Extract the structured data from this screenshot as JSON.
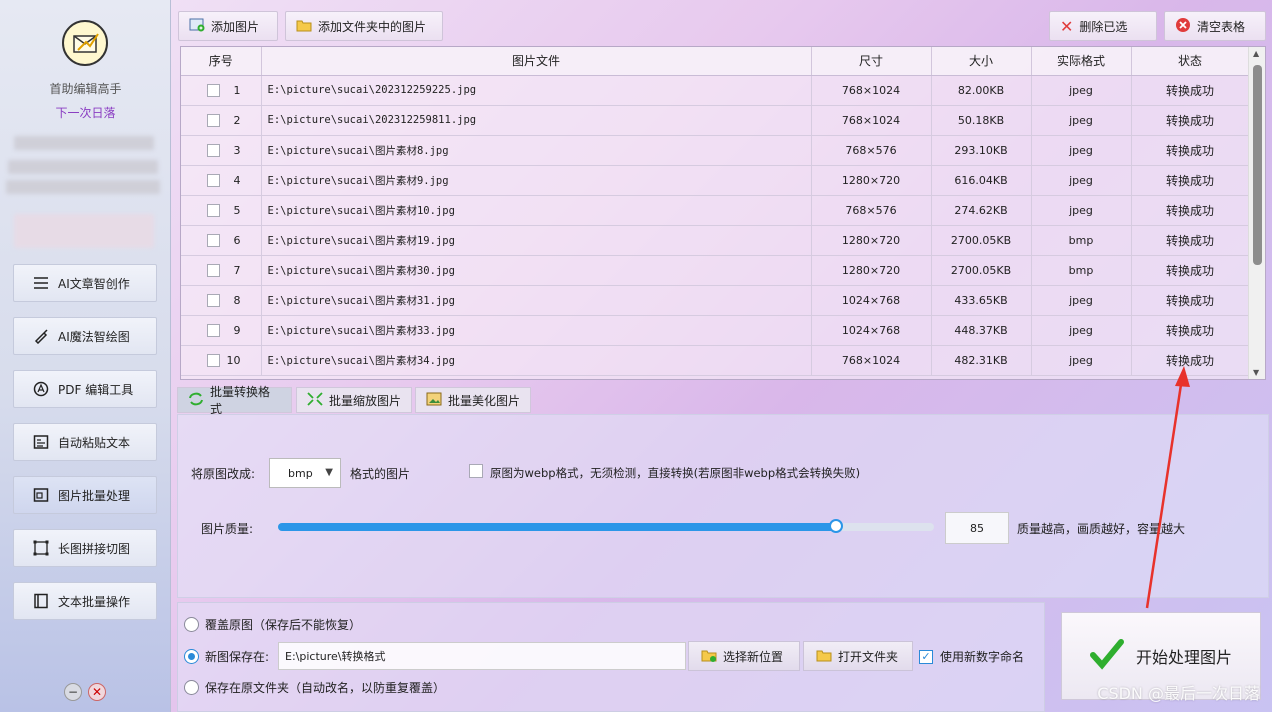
{
  "sidebar": {
    "app_name": "首助编辑高手",
    "user_name": "下一次日落",
    "items": [
      {
        "label": "AI文章智创作",
        "icon": "list-icon"
      },
      {
        "label": "AI魔法智绘图",
        "icon": "brush-icon"
      },
      {
        "label": "PDF 编辑工具",
        "icon": "pdf-icon"
      },
      {
        "label": "自动粘贴文本",
        "icon": "text-icon"
      },
      {
        "label": "图片批量处理",
        "icon": "image-icon"
      },
      {
        "label": "长图拼接切图",
        "icon": "crop-icon"
      },
      {
        "label": "文本批量操作",
        "icon": "book-icon"
      }
    ]
  },
  "toolbar": {
    "add_images": "添加图片",
    "add_folder_images": "添加文件夹中的图片",
    "delete_selected": "删除已选",
    "clear_table": "清空表格"
  },
  "table": {
    "headers": [
      "序号",
      "图片文件",
      "尺寸",
      "大小",
      "实际格式",
      "状态"
    ],
    "rows": [
      {
        "idx": "1",
        "file": "E:\\picture\\sucai\\202312259225.jpg",
        "size": "768×1024",
        "bytes": "82.00KB",
        "format": "jpeg",
        "status": "转换成功"
      },
      {
        "idx": "2",
        "file": "E:\\picture\\sucai\\202312259811.jpg",
        "size": "768×1024",
        "bytes": "50.18KB",
        "format": "jpeg",
        "status": "转换成功"
      },
      {
        "idx": "3",
        "file": "E:\\picture\\sucai\\图片素材8.jpg",
        "size": "768×576",
        "bytes": "293.10KB",
        "format": "jpeg",
        "status": "转换成功"
      },
      {
        "idx": "4",
        "file": "E:\\picture\\sucai\\图片素材9.jpg",
        "size": "1280×720",
        "bytes": "616.04KB",
        "format": "jpeg",
        "status": "转换成功"
      },
      {
        "idx": "5",
        "file": "E:\\picture\\sucai\\图片素材10.jpg",
        "size": "768×576",
        "bytes": "274.62KB",
        "format": "jpeg",
        "status": "转换成功"
      },
      {
        "idx": "6",
        "file": "E:\\picture\\sucai\\图片素材19.jpg",
        "size": "1280×720",
        "bytes": "2700.05KB",
        "format": "bmp",
        "status": "转换成功"
      },
      {
        "idx": "7",
        "file": "E:\\picture\\sucai\\图片素材30.jpg",
        "size": "1280×720",
        "bytes": "2700.05KB",
        "format": "bmp",
        "status": "转换成功"
      },
      {
        "idx": "8",
        "file": "E:\\picture\\sucai\\图片素材31.jpg",
        "size": "1024×768",
        "bytes": "433.65KB",
        "format": "jpeg",
        "status": "转换成功"
      },
      {
        "idx": "9",
        "file": "E:\\picture\\sucai\\图片素材33.jpg",
        "size": "1024×768",
        "bytes": "448.37KB",
        "format": "jpeg",
        "status": "转换成功"
      },
      {
        "idx": "10",
        "file": "E:\\picture\\sucai\\图片素材34.jpg",
        "size": "768×1024",
        "bytes": "482.31KB",
        "format": "jpeg",
        "status": "转换成功"
      }
    ]
  },
  "tabs": [
    "批量转换格式",
    "批量缩放图片",
    "批量美化图片"
  ],
  "convert": {
    "label_prefix": "将原图改成:",
    "format_value": "bmp",
    "label_suffix": "格式的图片",
    "webp_option": "原图为webp格式，无须检测，直接转换(若原图非webp格式会转换失败)",
    "quality_label": "图片质量:",
    "quality_value": "85",
    "quality_fraction": 0.85,
    "quality_hint": "质量越高，画质越好，容量越大"
  },
  "save": {
    "overwrite": "覆盖原图（保存后不能恢复）",
    "new_location_label": "新图保存在:",
    "path": "E:\\picture\\转换格式",
    "choose_location": "选择新位置",
    "open_folder": "打开文件夹",
    "use_numeric_naming": "使用新数字命名",
    "save_in_original": "保存在原文件夹（自动改名，以防重复覆盖）"
  },
  "start_button": "开始处理图片",
  "watermark": "CSDN @最后一次日落",
  "colors": {
    "accent": "#2b96e8",
    "success_green": "#2fae2f",
    "danger_red": "#e03b3b",
    "annotation_red": "#e8322b"
  }
}
